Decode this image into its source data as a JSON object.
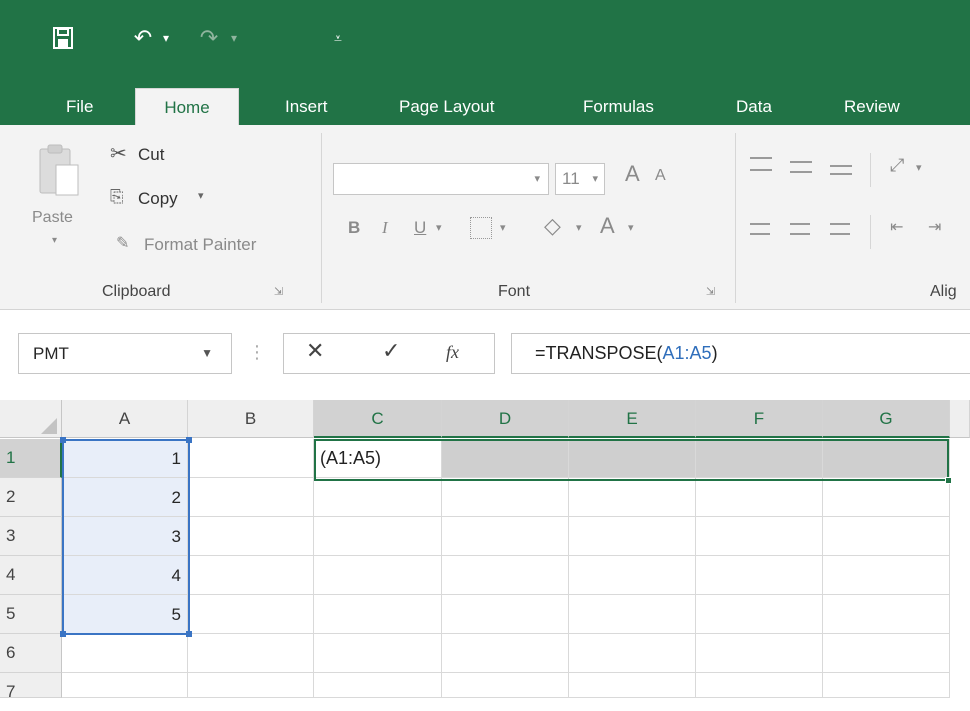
{
  "qat": {
    "save_icon": "save-icon",
    "undo_symbol": "↶",
    "redo_symbol": "↷",
    "dropdown_symbol": "▾",
    "customize_symbol": "⩡"
  },
  "tabs": [
    {
      "label": "File"
    },
    {
      "label": "Home",
      "active": true
    },
    {
      "label": "Insert"
    },
    {
      "label": "Page Layout"
    },
    {
      "label": "Formulas"
    },
    {
      "label": "Data"
    },
    {
      "label": "Review"
    }
  ],
  "ribbon": {
    "clipboard": {
      "paste_label": "Paste",
      "cut_label": "Cut",
      "copy_label": "Copy",
      "format_painter_label": "Format Painter",
      "group_label": "Clipboard"
    },
    "font": {
      "font_name": "",
      "font_size": "11",
      "bold": "B",
      "italic": "I",
      "underline": "U",
      "grow": "A",
      "shrink": "A",
      "font_color": "A",
      "group_label": "Font"
    },
    "alignment": {
      "group_label": "Alig"
    }
  },
  "formula_bar": {
    "name_box": "PMT",
    "cancel_symbol": "✕",
    "enter_symbol": "✓",
    "fx_symbol": "fx",
    "formula_prefix": "=TRANSPOSE(",
    "formula_ref": "A1:A5",
    "formula_suffix": ")"
  },
  "grid": {
    "columns": [
      "A",
      "B",
      "C",
      "D",
      "E",
      "F",
      "G"
    ],
    "rows": [
      "1",
      "2",
      "3",
      "4",
      "5",
      "6",
      "7"
    ],
    "values_A": [
      "1",
      "2",
      "3",
      "4",
      "5"
    ],
    "edit_text_C1": "(A1:A5)"
  },
  "colors": {
    "excel_green": "#217346",
    "reference_blue": "#3a74c4"
  }
}
